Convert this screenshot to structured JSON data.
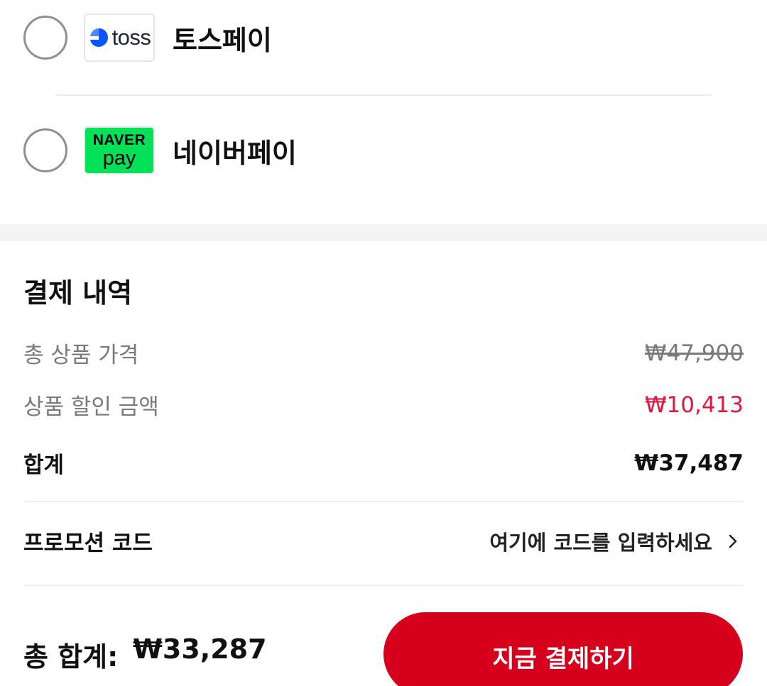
{
  "payment_methods": [
    {
      "name": "토스페이",
      "logo_text": "toss",
      "icon": "toss-logo-icon",
      "selected": false
    },
    {
      "name": "네이버페이",
      "logo_text_top": "NAVER",
      "logo_text_bottom": "pay",
      "icon": "naver-pay-logo-icon",
      "selected": false
    }
  ],
  "summary": {
    "title": "결제 내역",
    "rows": [
      {
        "label": "총 상품 가격",
        "value": "₩47,900"
      },
      {
        "label": "상품 할인 금액",
        "value": "₩10,413"
      },
      {
        "label": "합계",
        "value": "₩37,487"
      }
    ]
  },
  "promo": {
    "label": "프로모션 코드",
    "placeholder": "여기에 코드를 입력하세요",
    "icon": "chevron-right-icon"
  },
  "footer": {
    "total_label": "총 합계:",
    "total_value": "₩33,287",
    "pay_button_label": "지금 결제하기"
  },
  "colors": {
    "accent": "#d6001c",
    "discount": "#e2163f",
    "naver_green": "#03e158",
    "toss_blue": "#0064ff"
  }
}
